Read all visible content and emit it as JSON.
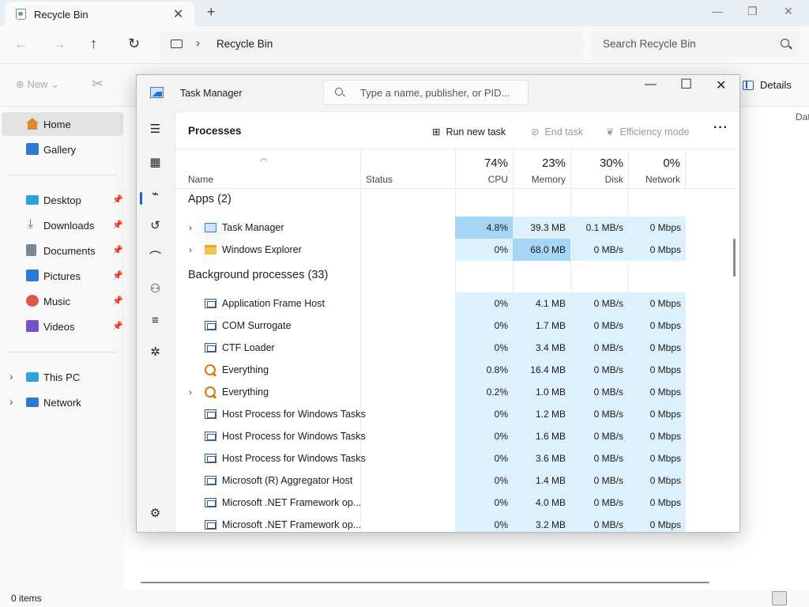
{
  "explorer": {
    "tab_title": "Recycle Bin",
    "new_tab": "+",
    "tab_close": "✕",
    "window_controls": {
      "minimize": "—",
      "maximize": "❐",
      "close": "✕"
    },
    "nav": {
      "back": "←",
      "forward": "→",
      "up": "↑",
      "refresh": "↻"
    },
    "address": {
      "chevron": "›",
      "location": "Recycle Bin"
    },
    "search_placeholder": "Search Recycle Bin",
    "commands": {
      "new_label": "New",
      "details_label": "Details"
    },
    "sidebar": {
      "items": [
        {
          "label": "Home",
          "icon": "home-icon",
          "color": "#e0882a"
        },
        {
          "label": "Gallery",
          "icon": "gallery-icon",
          "color": "#2b78d6"
        },
        {
          "label": "Desktop",
          "icon": "desktop-icon",
          "color": "#2aa3e0",
          "pinned": true
        },
        {
          "label": "Downloads",
          "icon": "download-icon",
          "color": "#2e9b4f",
          "pinned": true
        },
        {
          "label": "Documents",
          "icon": "documents-icon",
          "color": "#7b8796",
          "pinned": true
        },
        {
          "label": "Pictures",
          "icon": "pictures-icon",
          "color": "#2b78d6",
          "pinned": true
        },
        {
          "label": "Music",
          "icon": "music-icon",
          "color": "#e2564a",
          "pinned": true
        },
        {
          "label": "Videos",
          "icon": "videos-icon",
          "color": "#7a4fc8",
          "pinned": true
        },
        {
          "label": "This PC",
          "icon": "pc-icon",
          "color": "#2aa3e0",
          "expandable": true
        },
        {
          "label": "Network",
          "icon": "network-icon",
          "color": "#2b78d6",
          "expandable": true
        }
      ]
    },
    "column_header": "Dat",
    "status": {
      "items": "0 items"
    }
  },
  "task_manager": {
    "title": "Task Manager",
    "search_placeholder": "Type a name, publisher, or PID...",
    "window_controls": {
      "minimize": "—",
      "maximize": "☐",
      "close": "✕"
    },
    "page_title": "Processes",
    "actions": {
      "run_new_task": "Run new task",
      "end_task": "End task",
      "efficiency_mode": "Efficiency mode",
      "more": "···"
    },
    "columns": {
      "name": "Name",
      "status": "Status",
      "cpu": {
        "percent": "74%",
        "label": "CPU"
      },
      "memory": {
        "percent": "23%",
        "label": "Memory"
      },
      "disk": {
        "percent": "30%",
        "label": "Disk"
      },
      "network": {
        "percent": "0%",
        "label": "Network"
      }
    },
    "groups": {
      "apps": "Apps (2)",
      "background": "Background processes (33)"
    },
    "apps": [
      {
        "name": "Task Manager",
        "icon": "task-manager-icon",
        "expandable": true,
        "cpu": "4.8%",
        "memory": "39.3 MB",
        "disk": "0.1 MB/s",
        "network": "0 Mbps"
      },
      {
        "name": "Windows Explorer",
        "icon": "folder-icon",
        "expandable": true,
        "cpu": "0%",
        "memory": "68.0 MB",
        "disk": "0 MB/s",
        "network": "0 Mbps"
      }
    ],
    "background": [
      {
        "name": "Application Frame Host",
        "icon": "app-window-icon",
        "expandable": false,
        "cpu": "0%",
        "memory": "4.1 MB",
        "disk": "0 MB/s",
        "network": "0 Mbps"
      },
      {
        "name": "COM Surrogate",
        "icon": "app-window-icon",
        "expandable": false,
        "cpu": "0%",
        "memory": "1.7 MB",
        "disk": "0 MB/s",
        "network": "0 Mbps"
      },
      {
        "name": "CTF Loader",
        "icon": "app-window-icon",
        "expandable": false,
        "cpu": "0%",
        "memory": "3.4 MB",
        "disk": "0 MB/s",
        "network": "0 Mbps"
      },
      {
        "name": "Everything",
        "icon": "everything-search-icon",
        "expandable": false,
        "cpu": "0.8%",
        "memory": "16.4 MB",
        "disk": "0 MB/s",
        "network": "0 Mbps"
      },
      {
        "name": "Everything",
        "icon": "everything-search-icon",
        "expandable": true,
        "cpu": "0.2%",
        "memory": "1.0 MB",
        "disk": "0 MB/s",
        "network": "0 Mbps"
      },
      {
        "name": "Host Process for Windows Tasks",
        "icon": "app-window-icon",
        "expandable": false,
        "cpu": "0%",
        "memory": "1.2 MB",
        "disk": "0 MB/s",
        "network": "0 Mbps"
      },
      {
        "name": "Host Process for Windows Tasks",
        "icon": "app-window-icon",
        "expandable": false,
        "cpu": "0%",
        "memory": "1.6 MB",
        "disk": "0 MB/s",
        "network": "0 Mbps"
      },
      {
        "name": "Host Process for Windows Tasks",
        "icon": "app-window-icon",
        "expandable": false,
        "cpu": "0%",
        "memory": "3.6 MB",
        "disk": "0 MB/s",
        "network": "0 Mbps"
      },
      {
        "name": "Microsoft (R) Aggregator Host",
        "icon": "app-window-icon",
        "expandable": false,
        "cpu": "0%",
        "memory": "1.4 MB",
        "disk": "0 MB/s",
        "network": "0 Mbps"
      },
      {
        "name": "Microsoft .NET Framework op...",
        "icon": "app-window-icon",
        "expandable": false,
        "cpu": "0%",
        "memory": "4.0 MB",
        "disk": "0 MB/s",
        "network": "0 Mbps"
      },
      {
        "name": "Microsoft .NET Framework op...",
        "icon": "app-window-icon",
        "expandable": false,
        "cpu": "0%",
        "memory": "3.2 MB",
        "disk": "0 MB/s",
        "network": "0 Mbps"
      }
    ],
    "heat_colors": {
      "low": "#dcf0fd",
      "mid": "#bfe3fb",
      "high": "#a5d6f7"
    }
  }
}
